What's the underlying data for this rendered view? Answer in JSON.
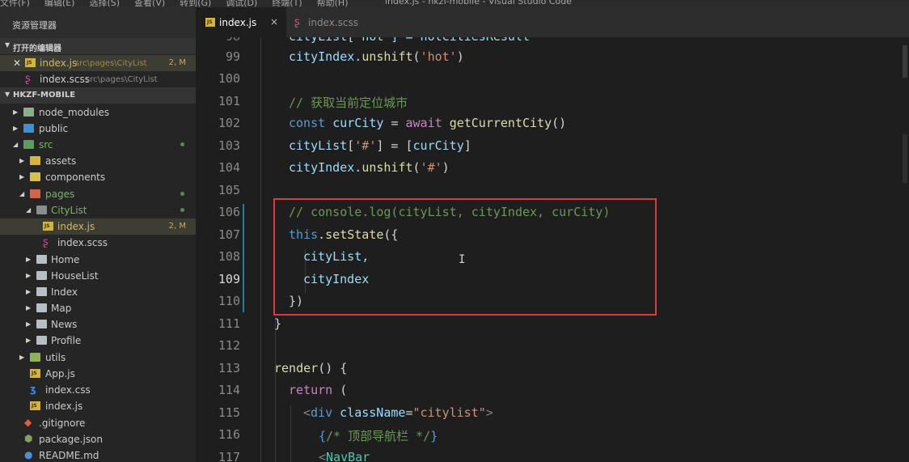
{
  "window": {
    "menu_items": [
      "文件(F)",
      "编辑(E)",
      "选择(S)",
      "查看(V)",
      "转到(G)",
      "调试(D)",
      "终端(T)",
      "帮助(H)"
    ],
    "title": "index.js - hkzf-mobile - Visual Studio Code"
  },
  "sidebar": {
    "header": "资源管理器",
    "open_editors": {
      "label": "打开的编辑器",
      "items": [
        {
          "name": "index.js",
          "path": "src\\pages\\CityList",
          "badge": "2, M"
        },
        {
          "name": "index.scss",
          "path": "src\\pages\\CityList",
          "badge": ""
        }
      ]
    },
    "project": {
      "label": "HKZF-MOBILE",
      "tree": [
        {
          "name": "node_modules"
        },
        {
          "name": "public"
        },
        {
          "name": "src"
        },
        {
          "name": "assets"
        },
        {
          "name": "components"
        },
        {
          "name": "pages"
        },
        {
          "name": "CityList"
        },
        {
          "name": "index.js",
          "badge": "2, M"
        },
        {
          "name": "index.scss"
        },
        {
          "name": "Home"
        },
        {
          "name": "HouseList"
        },
        {
          "name": "Index"
        },
        {
          "name": "Map"
        },
        {
          "name": "News"
        },
        {
          "name": "Profile"
        },
        {
          "name": "utils"
        },
        {
          "name": "App.js"
        },
        {
          "name": "index.css"
        },
        {
          "name": "index.js"
        },
        {
          "name": ".gitignore"
        },
        {
          "name": "package.json"
        },
        {
          "name": "README.md"
        }
      ]
    }
  },
  "tabs": [
    {
      "label": "index.js",
      "active": true
    },
    {
      "label": "index.scss",
      "active": false
    }
  ],
  "editor": {
    "lines": [
      {
        "num": "99",
        "text": "cityIndex.unshift('hot')"
      },
      {
        "num": "100",
        "text": ""
      },
      {
        "num": "101",
        "text": "// 获取当前定位城市"
      },
      {
        "num": "102",
        "text": "const curCity = await getCurrentCity()"
      },
      {
        "num": "103",
        "text": "cityList['#'] = [curCity]"
      },
      {
        "num": "104",
        "text": "cityIndex.unshift('#')"
      },
      {
        "num": "105",
        "text": ""
      },
      {
        "num": "106",
        "text": "// console.log(cityList, cityIndex, curCity)"
      },
      {
        "num": "107",
        "text": "this.setState({"
      },
      {
        "num": "108",
        "text": "cityList,"
      },
      {
        "num": "109",
        "text": "cityIndex"
      },
      {
        "num": "110",
        "text": "})"
      },
      {
        "num": "111",
        "text": "}"
      },
      {
        "num": "112",
        "text": ""
      },
      {
        "num": "113",
        "text": "render() {"
      },
      {
        "num": "114",
        "text": "return ("
      },
      {
        "num": "115",
        "text": "<div className=\"citylist\">"
      },
      {
        "num": "116",
        "text": "{/* 顶部导航栏 */}"
      },
      {
        "num": "117",
        "text": "<NavBar"
      }
    ]
  },
  "colors": {
    "keyword": "#569cd6",
    "string": "#ce9178",
    "comment": "#6a9955",
    "function": "#dcdcaa",
    "variable": "#9cdcfe",
    "highlight_box": "#e0393b"
  }
}
